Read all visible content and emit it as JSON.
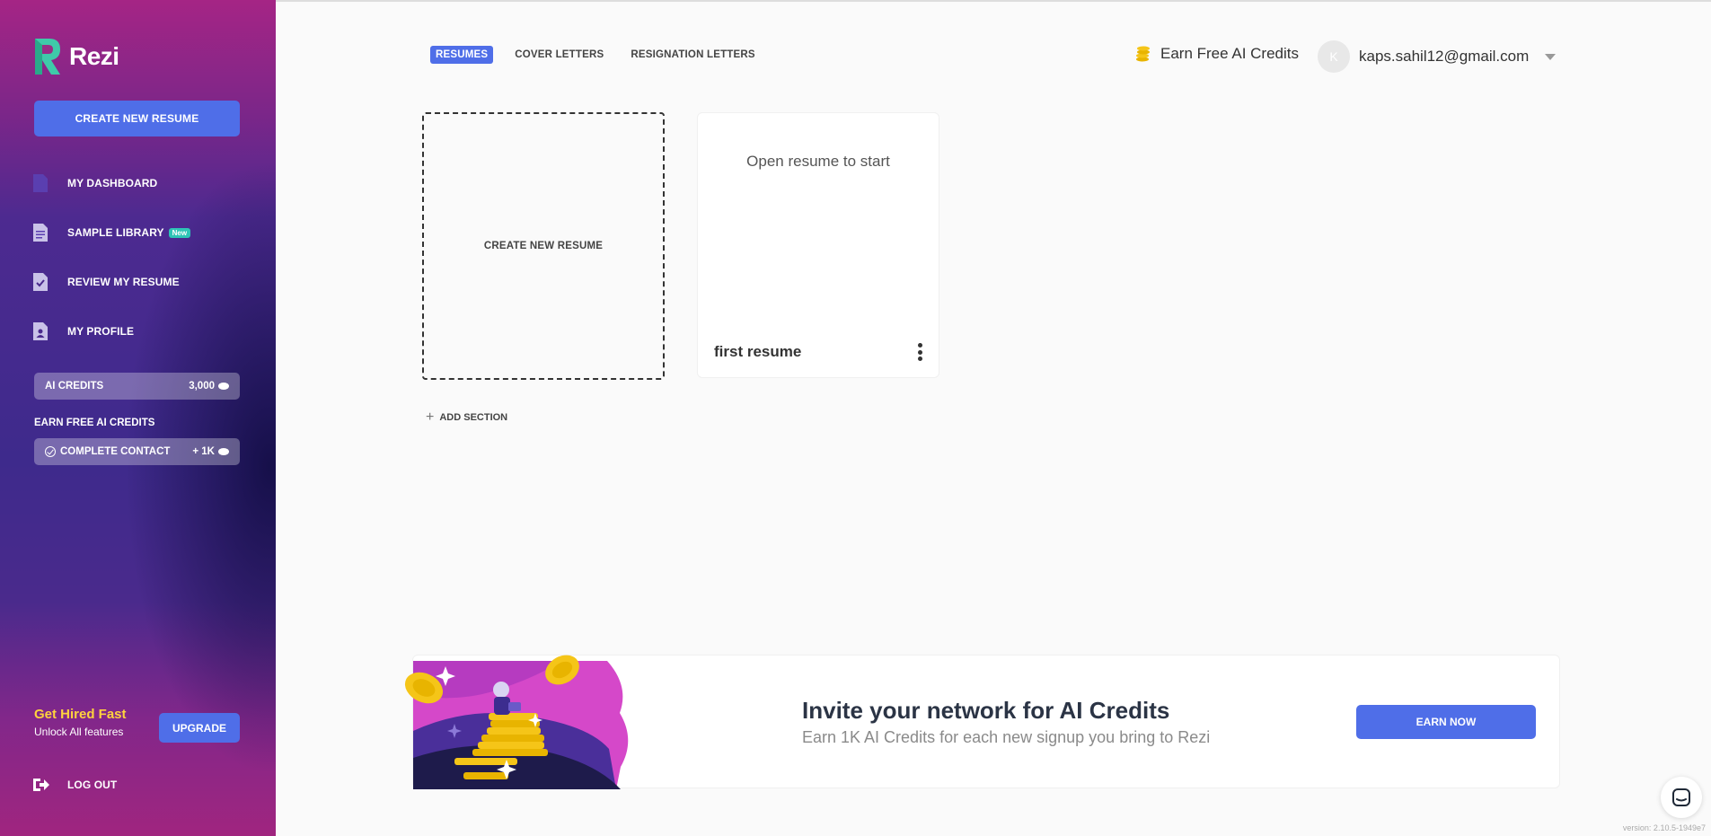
{
  "app": {
    "name": "Rezi",
    "colors": {
      "accent": "#4f6ee8",
      "highlight": "#ffd33d",
      "badge": "#2ec4b6"
    }
  },
  "sidebar": {
    "create_button": "CREATE NEW RESUME",
    "items": [
      {
        "label": "MY DASHBOARD",
        "icon": "document-icon"
      },
      {
        "label": "SAMPLE LIBRARY",
        "icon": "list-document-icon",
        "badge": "New"
      },
      {
        "label": "REVIEW MY RESUME",
        "icon": "check-document-icon"
      },
      {
        "label": "MY PROFILE",
        "icon": "profile-document-icon"
      }
    ],
    "ai_credits": {
      "label": "AI CREDITS",
      "value": "3,000"
    },
    "earn_label": "EARN FREE AI CREDITS",
    "complete_contact": {
      "label": "COMPLETE CONTACT",
      "value": "+ 1K"
    },
    "promo": {
      "title": "Get Hired Fast",
      "subtitle": "Unlock All features",
      "button": "UPGRADE"
    },
    "logout": "LOG OUT"
  },
  "header": {
    "tabs": [
      {
        "label": "RESUMES",
        "active": true
      },
      {
        "label": "COVER LETTERS",
        "active": false
      },
      {
        "label": "RESIGNATION LETTERS",
        "active": false
      }
    ],
    "earn_link": "Earn Free AI Credits",
    "user": {
      "initial": "K",
      "email": "kaps.sahil12@gmail.com"
    }
  },
  "main": {
    "create_card": "CREATE NEW RESUME",
    "resume_card": {
      "hint": "Open resume to start",
      "title": "first resume"
    },
    "add_section": "ADD SECTION"
  },
  "banner": {
    "title": "Invite your network for AI Credits",
    "subtitle": "Earn 1K AI Credits for each new signup you bring to Rezi",
    "button": "EARN NOW"
  },
  "footer": {
    "version": "version: 2.10.5-1949e7"
  }
}
